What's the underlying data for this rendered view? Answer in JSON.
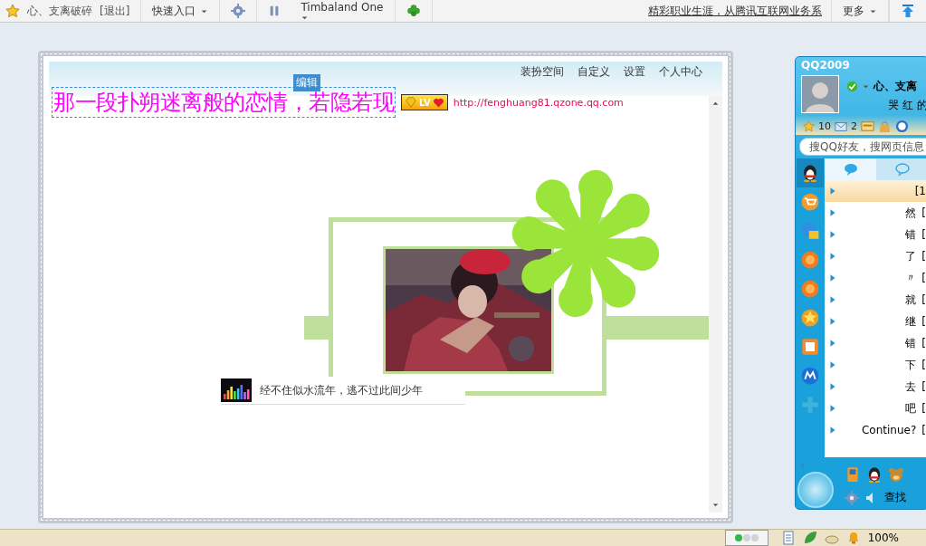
{
  "top_bar": {
    "user": "心、支离破碎",
    "logout": "[退出]",
    "quick_entry": "快速入口",
    "song": "Timbaland One",
    "promo_link": "精彩职业生涯，从腾讯互联网业务系",
    "more": "更多"
  },
  "space": {
    "nav": [
      "装扮空间",
      "自定义",
      "设置",
      "个人中心"
    ],
    "edit_badge": "编辑",
    "title": "那一段扑朔迷离般的恋情，若隐若现",
    "level_badge": "LV",
    "url": "http://fenghuang81.qzone.qq.com",
    "music_caption": "经不住似水流年，逃不过此间少年"
  },
  "qq_panel": {
    "title": "QQ2009",
    "nickname": "心、支离",
    "signature": "哭 红 的",
    "level_count": "10",
    "mail_count": "2",
    "search_placeholder": "搜QQ好友，搜网页信息",
    "tabs": [
      {
        "selected": true
      },
      {
        "selected": false
      }
    ],
    "contacts": [
      {
        "bracket": "[1",
        "selected": true
      },
      {
        "name": "然",
        "bracket": "[",
        "selected": false
      },
      {
        "name": "错",
        "bracket": "[",
        "selected": false
      },
      {
        "name": "了",
        "bracket": "[",
        "selected": false
      },
      {
        "name": "〃",
        "bracket": "[",
        "selected": false
      },
      {
        "name": "就",
        "bracket": "[",
        "selected": false
      },
      {
        "name": "继",
        "bracket": "[",
        "selected": false
      },
      {
        "name": "错",
        "bracket": "[",
        "selected": false
      },
      {
        "name": "下",
        "bracket": "[",
        "selected": false
      },
      {
        "name": "去",
        "bracket": "[",
        "selected": false
      },
      {
        "name": "吧",
        "bracket": "[",
        "selected": false
      },
      {
        "name": "Continue?",
        "bracket": "[",
        "selected": false
      }
    ],
    "find": "查找"
  },
  "taskbar": {
    "zoom": "100%"
  }
}
